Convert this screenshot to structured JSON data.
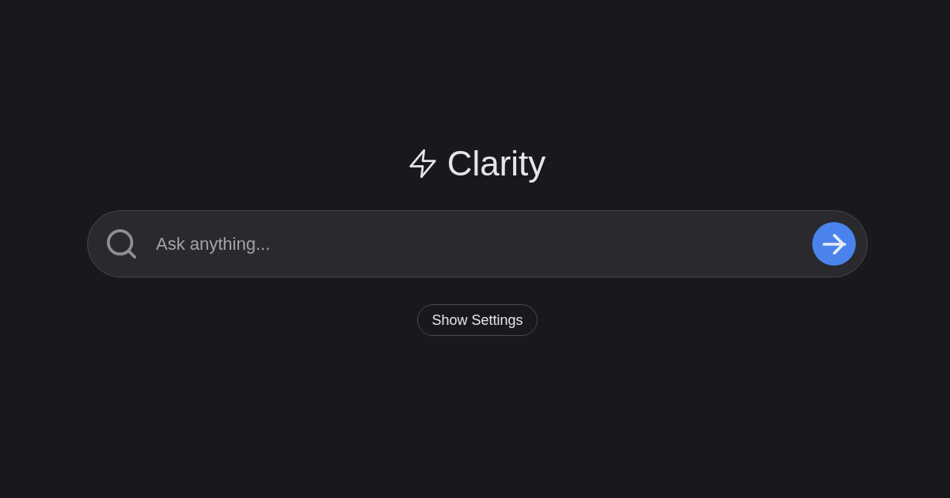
{
  "header": {
    "title": "Clarity"
  },
  "search": {
    "placeholder": "Ask anything..."
  },
  "settings_button": {
    "label": "Show Settings"
  }
}
